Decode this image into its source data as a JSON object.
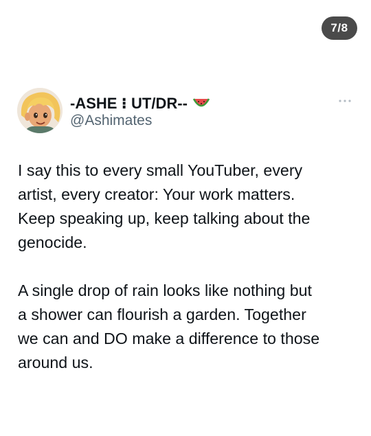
{
  "carousel": {
    "position_label": "7/8"
  },
  "post": {
    "author": {
      "display_name": "-ASHE ⁝ UT/DR--",
      "name_emoji": "watermelon-emoji",
      "handle": "@Ashimates",
      "avatar_icon": "cartoon-avatar-icon"
    },
    "menu_icon": "more-horizontal-icon",
    "paragraphs": [
      "I say this to every small YouTuber, every\nartist, every creator: Your work matters.\nKeep speaking up, keep talking about the\ngenocide.",
      "A single drop of rain looks like nothing but\na shower can flourish a garden. Together\nwe can and DO make a difference to those\naround us."
    ]
  },
  "colors": {
    "text_primary": "#0f1419",
    "text_secondary": "#536471",
    "counter_bg": "#4a4a4a",
    "background": "#ffffff"
  }
}
